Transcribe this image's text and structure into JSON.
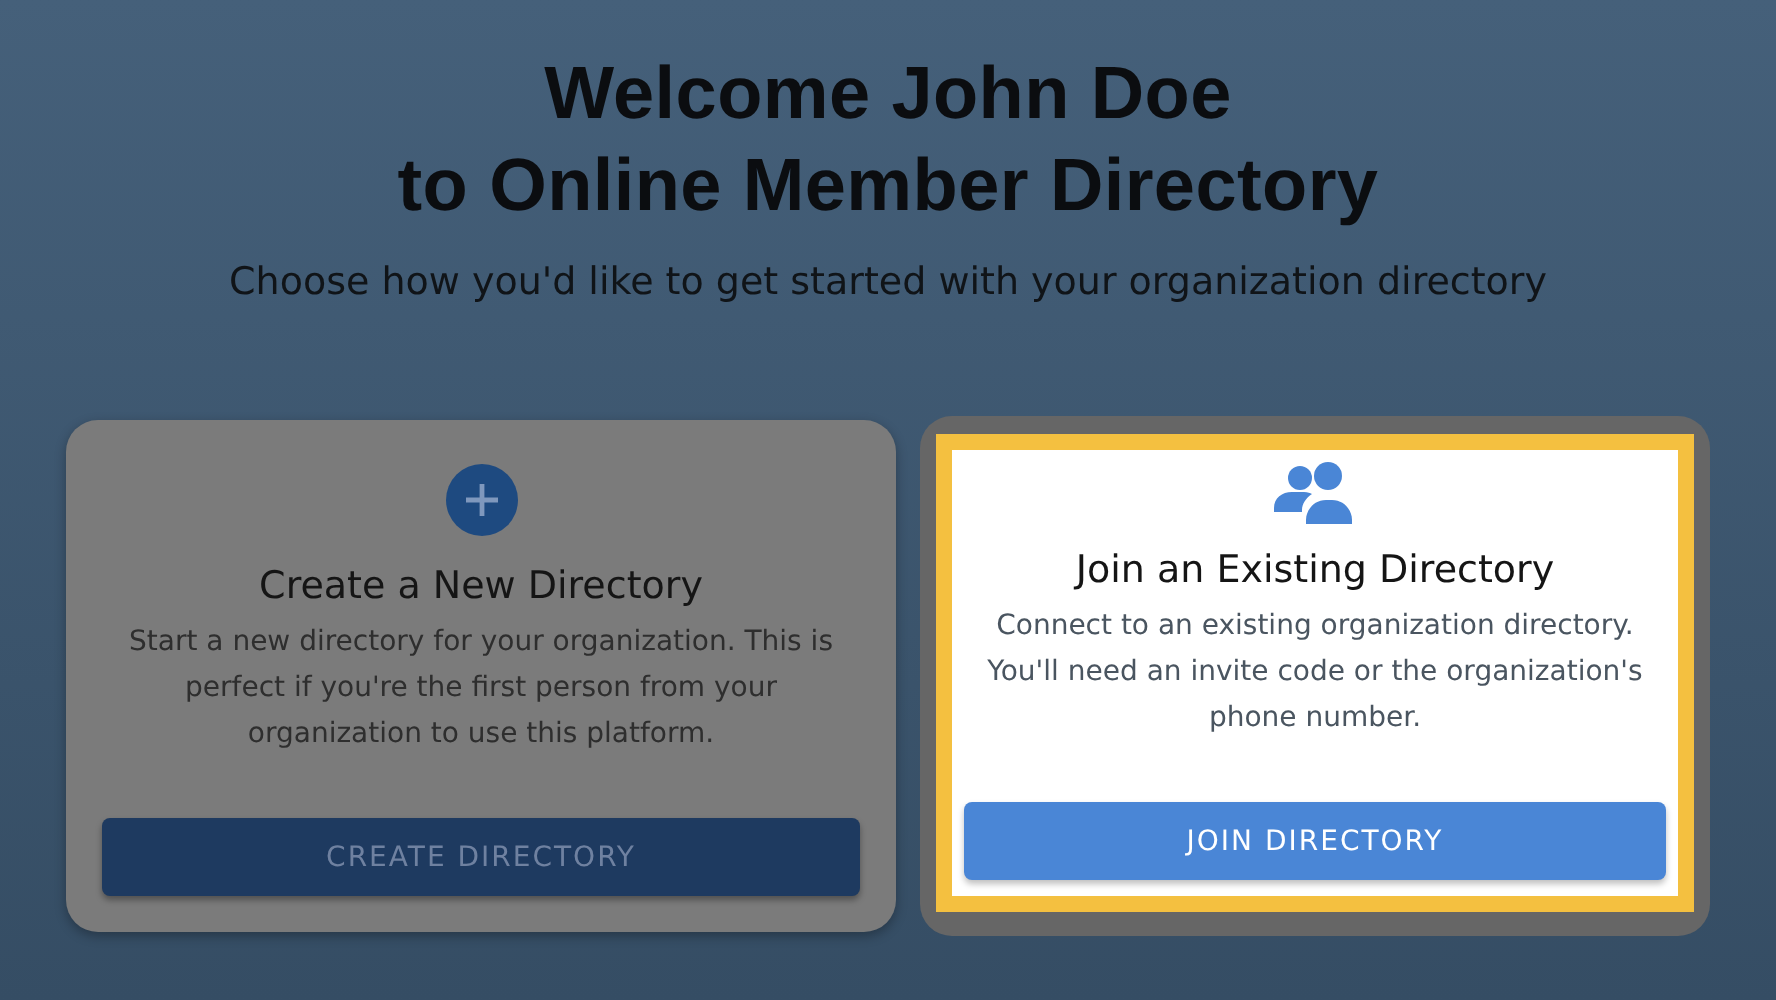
{
  "heading": {
    "lines": [
      "Welcome John Doe",
      "to Online Member Directory"
    ]
  },
  "subtitle": "Choose how you'd like to get started with your organization directory",
  "cards": [
    {
      "kind": "create",
      "title": "Create a New Directory",
      "description": "Start a new directory for your organization. This is perfect if you're the first person from your organization to use this platform.",
      "button": "CREATE DIRECTORY",
      "highlighted": false
    },
    {
      "kind": "join",
      "title": "Join an Existing Directory",
      "description": "Connect to an existing organization directory. You'll need an invite code or the organization's phone number.",
      "button": "JOIN DIRECTORY",
      "highlighted": true
    }
  ]
}
